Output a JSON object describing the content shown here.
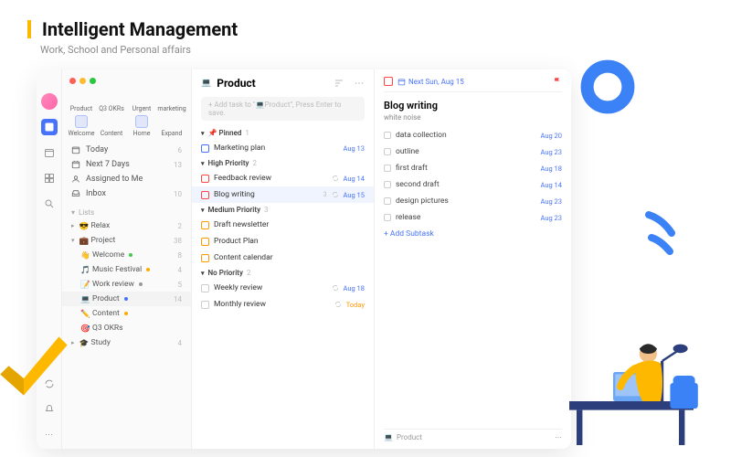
{
  "hero": {
    "title": "Intelligent Management",
    "subtitle": "Work, School and Personal affairs"
  },
  "quickAccess": [
    {
      "label": "Product",
      "color": "#333"
    },
    {
      "label": "Q3 OKRs",
      "color": "#333"
    },
    {
      "label": "Urgent",
      "color": "#f55"
    },
    {
      "label": "marketing",
      "color": "#4c4"
    },
    {
      "label": "Welcome",
      "color": "#4772FA"
    },
    {
      "label": "Content",
      "color": "#fa0"
    },
    {
      "label": "Home",
      "color": "#4772FA"
    },
    {
      "label": "Expand",
      "color": "#999"
    }
  ],
  "smartLists": [
    {
      "icon": "today",
      "label": "Today",
      "count": "6"
    },
    {
      "icon": "week",
      "label": "Next 7 Days",
      "count": "13"
    },
    {
      "icon": "assigned",
      "label": "Assigned to Me",
      "count": ""
    },
    {
      "icon": "inbox",
      "label": "Inbox",
      "count": "10"
    }
  ],
  "sections": {
    "lists": "Lists"
  },
  "lists": [
    {
      "icon": "😎",
      "label": "Relax",
      "count": "2",
      "indent": 0
    },
    {
      "icon": "💼",
      "label": "Project",
      "count": "38",
      "indent": 0,
      "expanded": true
    },
    {
      "icon": "👋",
      "label": "Welcome",
      "count": "8",
      "indent": 1,
      "dot": "#4c4"
    },
    {
      "icon": "🎵",
      "label": "Music Festival",
      "count": "4",
      "indent": 1,
      "dot": "#fa0"
    },
    {
      "icon": "📝",
      "label": "Work review",
      "count": "5",
      "indent": 1,
      "dot": "#999"
    },
    {
      "icon": "💻",
      "label": "Product",
      "count": "14",
      "indent": 1,
      "selected": true,
      "dot": "#4772FA"
    },
    {
      "icon": "✏️",
      "label": "Content",
      "count": "",
      "indent": 1,
      "dot": "#fa0"
    },
    {
      "icon": "🎯",
      "label": "Q3 OKRs",
      "count": "",
      "indent": 1
    },
    {
      "icon": "🎓",
      "label": "Study",
      "count": "4",
      "indent": 0
    }
  ],
  "taskList": {
    "title": "Product",
    "titleIcon": "💻",
    "addPlaceholder": "+ Add task to \"💻Product\", Press Enter to save.",
    "groups": [
      {
        "name": "📌 Pinned",
        "count": "1",
        "tasks": [
          {
            "name": "Marketing plan",
            "date": "Aug 13",
            "check": "blue"
          }
        ]
      },
      {
        "name": "High Priority",
        "count": "2",
        "tasks": [
          {
            "name": "Feedback review",
            "date": "Aug 14",
            "check": "red",
            "repeat": true
          },
          {
            "name": "Blog writing",
            "date": "Aug 15",
            "check": "red",
            "sub": "3",
            "repeat": true,
            "selected": true
          }
        ]
      },
      {
        "name": "Medium Priority",
        "count": "3",
        "tasks": [
          {
            "name": "Draft newsletter",
            "check": "orange"
          },
          {
            "name": "Product Plan",
            "check": "orange"
          },
          {
            "name": "Content calendar",
            "check": "orange"
          }
        ]
      },
      {
        "name": "No Priority",
        "count": "2",
        "tasks": [
          {
            "name": "Weekly review",
            "date": "Aug 18",
            "repeat": true
          },
          {
            "name": "Monthly review",
            "date": "Today",
            "dateWarn": true,
            "repeat": true
          }
        ]
      }
    ]
  },
  "detail": {
    "dateLabel": "Next Sun, Aug 15",
    "title": "Blog writing",
    "note": "white noise",
    "subtasks": [
      {
        "name": "data collection",
        "date": "Aug 20"
      },
      {
        "name": "outline",
        "date": "Aug 23"
      },
      {
        "name": "first draft",
        "date": "Aug 18"
      },
      {
        "name": "second draft",
        "date": "Aug 14"
      },
      {
        "name": "design pictures",
        "date": "Aug 23"
      },
      {
        "name": "release",
        "date": "Aug 23"
      }
    ],
    "addSubtask": "+  Add Subtask",
    "footerList": "Product",
    "footerIcon": "💻"
  }
}
